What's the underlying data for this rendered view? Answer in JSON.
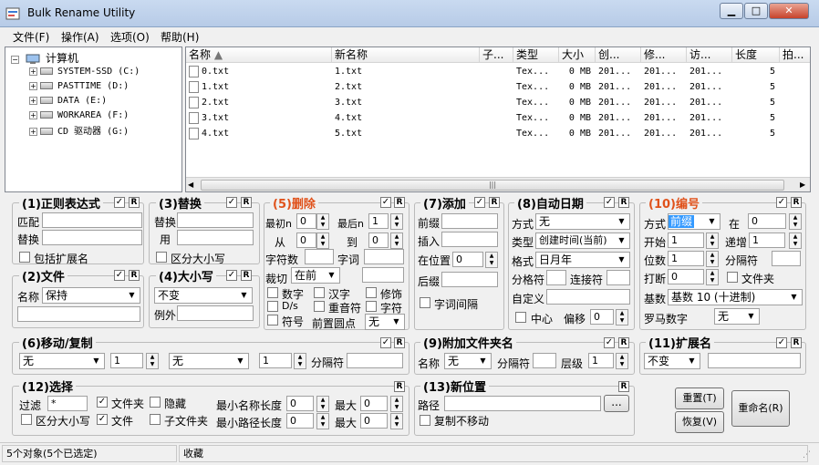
{
  "window": {
    "title": "Bulk Rename Utility",
    "minimize": "▁",
    "maximize": "□",
    "close": "✕"
  },
  "menu": [
    "文件(F)",
    "操作(A)",
    "选项(O)",
    "帮助(H)"
  ],
  "tree": {
    "root": "计算机",
    "drives": [
      {
        "name": "SYSTEM-SSD (C:)"
      },
      {
        "name": "PASTTIME (D:)"
      },
      {
        "name": "DATA (E:)"
      },
      {
        "name": "WORKAREA (F:)"
      },
      {
        "name": "CD 驱动器 (G:)"
      }
    ]
  },
  "file_list": {
    "columns": [
      "名称",
      "新名称",
      "子...",
      "类型",
      "大小",
      "创...",
      "修...",
      "访...",
      "长度",
      "拍..."
    ],
    "rows": [
      [
        "0.txt",
        "1.txt",
        "",
        "Tex...",
        "0 MB",
        "201...",
        "201...",
        "201...",
        "5",
        ""
      ],
      [
        "1.txt",
        "2.txt",
        "",
        "Tex...",
        "0 MB",
        "201...",
        "201...",
        "201...",
        "5",
        ""
      ],
      [
        "2.txt",
        "3.txt",
        "",
        "Tex...",
        "0 MB",
        "201...",
        "201...",
        "201...",
        "5",
        ""
      ],
      [
        "3.txt",
        "4.txt",
        "",
        "Tex...",
        "0 MB",
        "201...",
        "201...",
        "201...",
        "5",
        ""
      ],
      [
        "4.txt",
        "5.txt",
        "",
        "Tex...",
        "0 MB",
        "201...",
        "201...",
        "201...",
        "5",
        ""
      ]
    ]
  },
  "g1": {
    "title": "(1)正则表达式",
    "match": "匹配",
    "replace": "替换",
    "include_ext": "包括扩展名"
  },
  "g2": {
    "title": "(2)文件",
    "name_label": "名称",
    "name_value": "保持"
  },
  "g3": {
    "title": "(3)替换",
    "replace": "替换",
    "with": "用",
    "case_sensitive": "区分大小写"
  },
  "g4": {
    "title": "(4)大小写",
    "value": "不变",
    "except": "例外"
  },
  "g5": {
    "title": "(5)删除",
    "first_n": "最初n",
    "first_n_val": "0",
    "last_n": "最后n",
    "last_n_val": "1",
    "from": "从",
    "from_val": "0",
    "to": "到",
    "to_val": "0",
    "chars": "字符数",
    "words": "字词",
    "crop": "裁切",
    "crop_val": "在前",
    "digits": "数字",
    "hanzi": "汉字",
    "trim": "修饰",
    "ds": "D/s",
    "accents": "重音符",
    "chars2": "字符",
    "symbols": "符号",
    "lead_dots": "前置圆点",
    "lead_dots_val": "无"
  },
  "g7": {
    "title": "(7)添加",
    "prefix": "前缀",
    "insert": "插入",
    "at_pos": "在位置",
    "at_pos_val": "0",
    "suffix": "后缀",
    "word_space": "字词间隔"
  },
  "g8": {
    "title": "(8)自动日期",
    "mode": "方式",
    "mode_val": "无",
    "type": "类型",
    "type_val": "创建时间(当前)",
    "format": "格式",
    "format_val": "日月年",
    "sep": "分格符",
    "connect": "连接符",
    "custom": "自定义",
    "center": "中心",
    "offset": "偏移",
    "offset_val": "0"
  },
  "g10": {
    "title": "(10)编号",
    "mode": "方式",
    "mode_val": "前缀",
    "at": "在",
    "at_val": "0",
    "start": "开始",
    "start_val": "1",
    "incr": "递增",
    "incr_val": "1",
    "pad": "位数",
    "pad_val": "1",
    "sep": "分隔符",
    "brk": "打断",
    "brk_val": "0",
    "folder": "文件夹",
    "base": "基数",
    "base_val": "基数 10 (十进制)",
    "roman": "罗马数字",
    "roman_val": "无"
  },
  "g6": {
    "title": "(6)移动/复制",
    "val1": "无",
    "num1": "1",
    "val2": "无",
    "num2": "1",
    "sep": "分隔符"
  },
  "g9": {
    "title": "(9)附加文件夹名",
    "name": "名称",
    "name_val": "无",
    "sep": "分隔符",
    "levels": "层级",
    "levels_val": "1"
  },
  "g11": {
    "title": "(11)扩展名",
    "value": "不变"
  },
  "g12": {
    "title": "(12)选择",
    "filter": "过滤",
    "filter_val": "*",
    "folders": "文件夹",
    "hidden": "隐藏",
    "min_name": "最小名称长度",
    "min_name_val": "0",
    "max": "最大",
    "max1_val": "0",
    "case": "区分大小写",
    "files": "文件",
    "subfolders": "子文件夹",
    "min_path": "最小路径长度",
    "min_path_val": "0",
    "max2_val": "0"
  },
  "g13": {
    "title": "(13)新位置",
    "path": "路径",
    "browse": "...",
    "copy_not_move": "复制不移动"
  },
  "buttons": {
    "reset": "重置(T)",
    "revert": "恢复(V)",
    "rename": "重命名(R)"
  },
  "status": {
    "left": "5个对象(5个已选定)",
    "right": "收藏"
  },
  "r": "R",
  "check": "✓",
  "colors": {
    "red_title": "#e0521b",
    "selection": "#3399ff"
  }
}
